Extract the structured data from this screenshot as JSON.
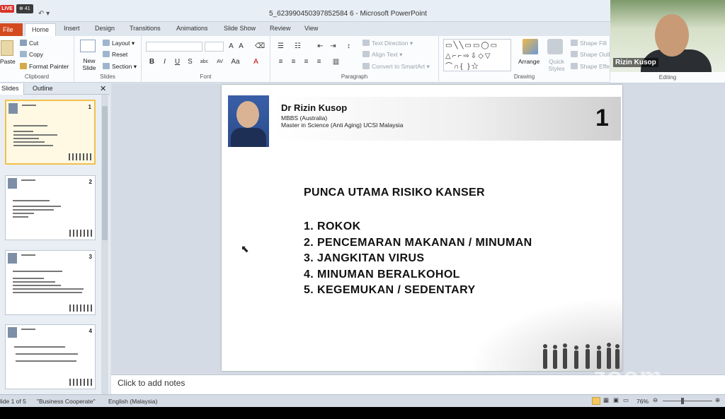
{
  "window": {
    "title": "5_623990450397852584 6 - Microsoft PowerPoint",
    "live_badge": "LIVE",
    "viewers": "⊕ 41"
  },
  "tabs": [
    "File",
    "Home",
    "Insert",
    "Design",
    "Transitions",
    "Animations",
    "Slide Show",
    "Review",
    "View"
  ],
  "ribbon": {
    "clipboard": {
      "paste": "Paste",
      "cut": "Cut",
      "copy": "Copy",
      "format_painter": "Format Painter",
      "label": "Clipboard"
    },
    "slides": {
      "new_slide": "New Slide",
      "layout": "Layout",
      "reset": "Reset",
      "section": "Section",
      "label": "Slides"
    },
    "font": {
      "label": "Font"
    },
    "paragraph": {
      "text_direction": "Text Direction",
      "align_text": "Align Text",
      "convert": "Convert to SmartArt",
      "label": "Paragraph"
    },
    "drawing": {
      "arrange": "Arrange",
      "quick_styles": "Quick Styles",
      "shape_fill": "Shape Fill",
      "shape_outline": "Shape Outl",
      "shape_effects": "Shape Effe",
      "label": "Drawing"
    },
    "editing": {
      "label": "Editing"
    }
  },
  "panel_tabs": {
    "slides": "Slides",
    "outline": "Outline"
  },
  "thumbnails": [
    {
      "number": "1"
    },
    {
      "number": "2"
    },
    {
      "number": "3"
    },
    {
      "number": "4"
    }
  ],
  "slide": {
    "name": "Dr Rizin Kusop",
    "credential1": "MBBS (Australia)",
    "credential2": "Master in Science (Anti Aging) UCSI Malaysia",
    "number": "1",
    "heading": "PUNCA UTAMA RISIKO KANSER",
    "items": [
      "1. ROKOK",
      "2. PENCEMARAN MAKANAN / MINUMAN",
      "3. JANGKITAN VIRUS",
      "4. MINUMAN BERALKOHOL",
      "5. KEGEMUKAN / SEDENTARY"
    ]
  },
  "notes": {
    "placeholder": "Click to add notes"
  },
  "status": {
    "slide": "lide 1 of 5",
    "theme": "\"Business Cooperate\"",
    "language": "English (Malaysia)",
    "zoom": "76%"
  },
  "watermark": "zoom",
  "participant": {
    "name": "Rizin Kusop"
  }
}
